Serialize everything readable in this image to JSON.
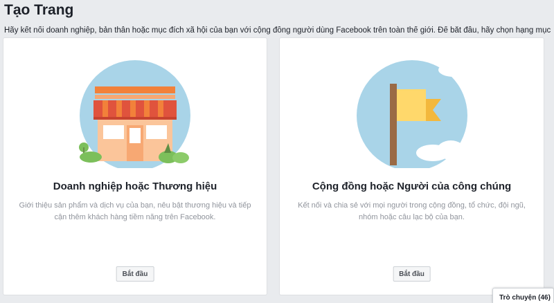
{
  "header": {
    "title": "Tạo Trang",
    "description": "Hãy kết nối doanh nghiệp, bản thân hoặc mục đích xã hội của bạn với cộng đồng người dùng Facebook trên toàn thế giới. Để bắt đầu, hãy chọn hạng mục"
  },
  "cards": [
    {
      "title": "Doanh nghiệp hoặc Thương hiệu",
      "description": "Giới thiệu sản phẩm và dịch vụ của bạn, nêu bật thương hiệu và tiếp cận thêm khách hàng tiềm năng trên Facebook.",
      "button_label": "Bắt đầu",
      "icon": "storefront-icon"
    },
    {
      "title": "Cộng đồng hoặc Người của công chúng",
      "description": "Kết nối và chia sẻ với mọi người trong cộng đồng, tổ chức, đội ngũ, nhóm hoặc câu lạc bộ của bạn.",
      "button_label": "Bắt đầu",
      "icon": "flag-icon"
    }
  ],
  "chat": {
    "label": "Trò chuyện (46)"
  },
  "colors": {
    "background": "#e9ebee",
    "illustration_circle": "#a9d4e8",
    "awning_red": "#e0533d",
    "awning_orange": "#f2813a",
    "flag_yellow": "#ffd86b",
    "flag_pole": "#9a6a45",
    "bush_green": "#7cbf5b"
  }
}
